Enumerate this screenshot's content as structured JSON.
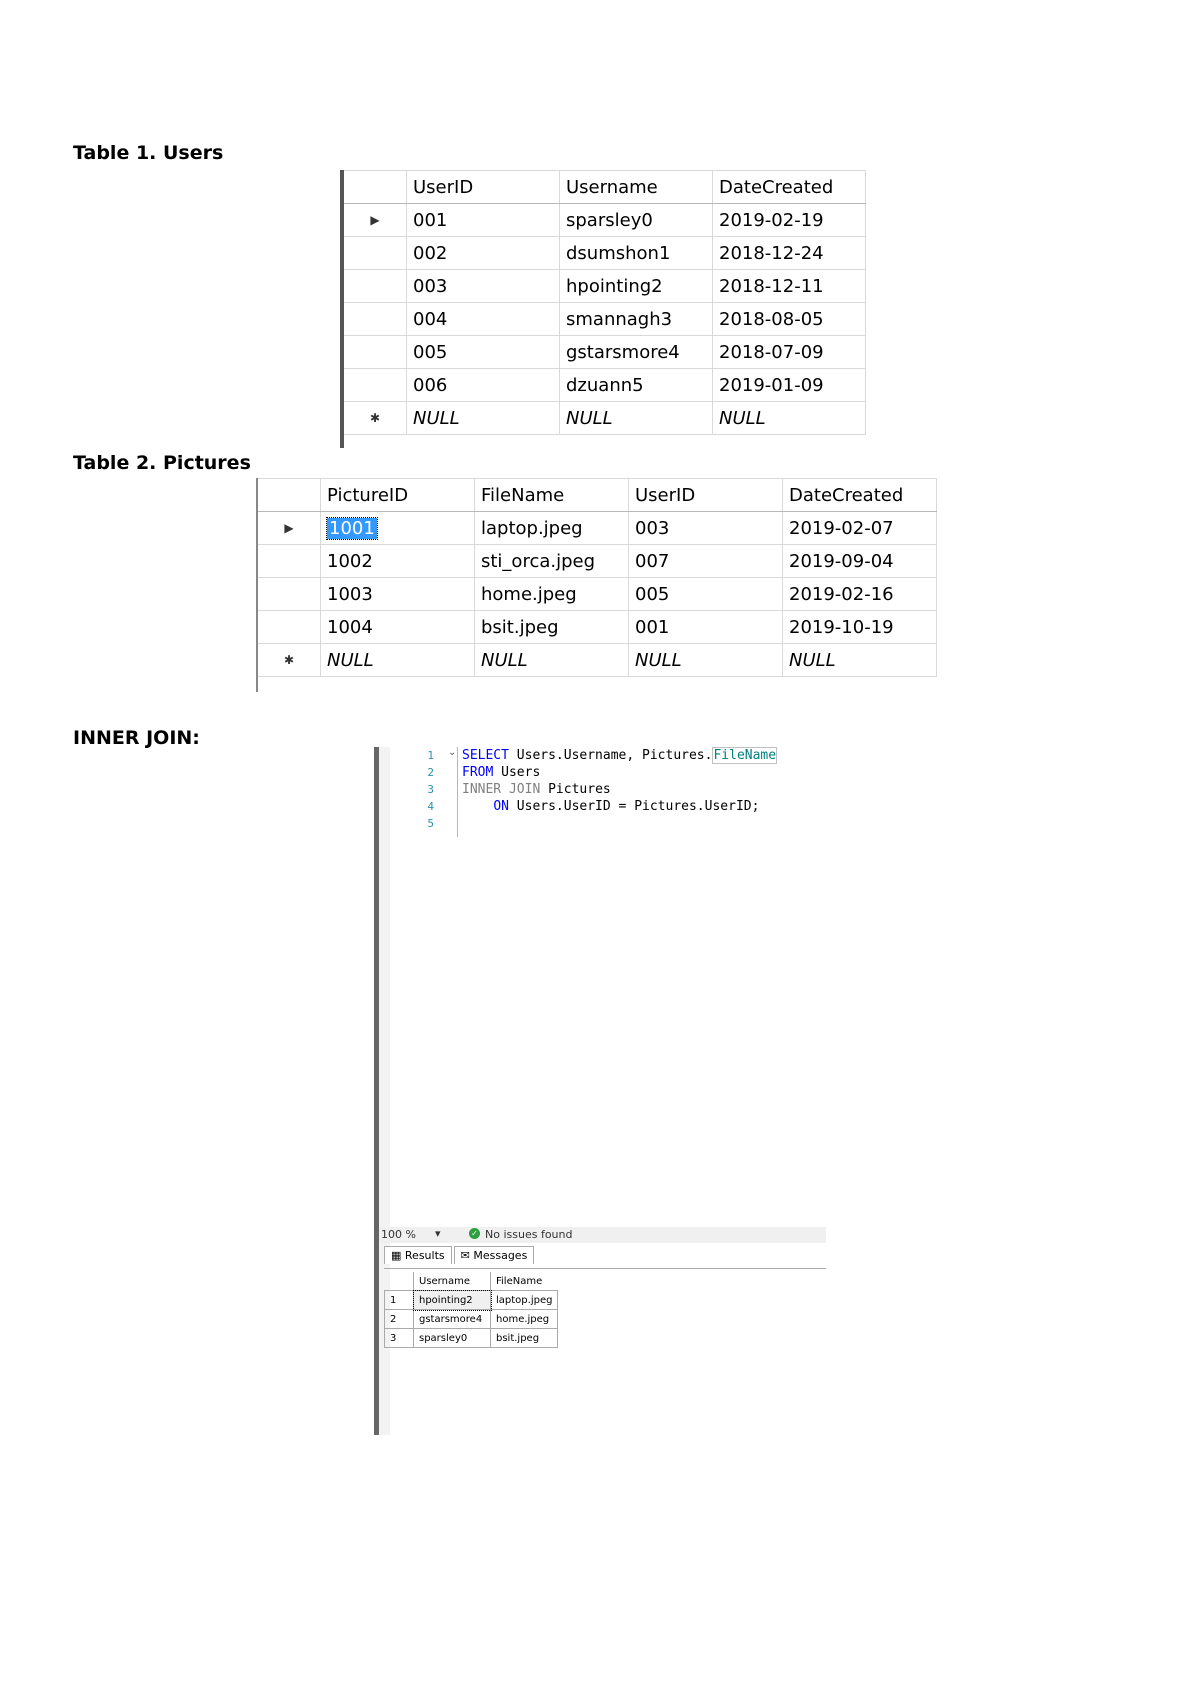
{
  "headings": {
    "users": "Table 1. Users",
    "pictures": "Table 2. Pictures",
    "inner_join": "INNER JOIN:"
  },
  "users": {
    "columns": [
      "UserID",
      "Username",
      "DateCreated"
    ],
    "rows": [
      [
        "001",
        "sparsley0",
        "2019-02-19"
      ],
      [
        "002",
        "dsumshon1",
        "2018-12-24"
      ],
      [
        "003",
        "hpointing2",
        "2018-12-11"
      ],
      [
        "004",
        "smannagh3",
        "2018-08-05"
      ],
      [
        "005",
        "gstarsmore4",
        "2018-07-09"
      ],
      [
        "006",
        "dzuann5",
        "2019-01-09"
      ]
    ],
    "null_row": [
      "NULL",
      "NULL",
      "NULL"
    ]
  },
  "pictures": {
    "columns": [
      "PictureID",
      "FileName",
      "UserID",
      "DateCreated"
    ],
    "rows": [
      [
        "1001",
        "laptop.jpeg",
        "003",
        "2019-02-07"
      ],
      [
        "1002",
        "sti_orca.jpeg",
        "007",
        "2019-09-04"
      ],
      [
        "1003",
        "home.jpeg",
        "005",
        "2019-02-16"
      ],
      [
        "1004",
        "bsit.jpeg",
        "001",
        "2019-10-19"
      ]
    ],
    "null_row": [
      "NULL",
      "NULL",
      "NULL",
      "NULL"
    ]
  },
  "editor": {
    "line_numbers": [
      "1",
      "2",
      "3",
      "4",
      "5"
    ],
    "code": {
      "l1_kw": "SELECT",
      "l1_rest": " Users.Username, Pictures.",
      "l1_sel": "FileName",
      "l2_kw": "FROM",
      "l2_rest": " Users",
      "l3_kw": "INNER JOIN",
      "l3_rest": " Pictures",
      "l4_kw": "ON",
      "l4_rest": " Users.UserID = Pictures.UserID;"
    },
    "zoom": "100 %",
    "status_text": "No issues found",
    "tabs": [
      "Results",
      "Messages"
    ]
  },
  "results": {
    "columns": [
      "Username",
      "FileName"
    ],
    "rows": [
      [
        "1",
        "hpointing2",
        "laptop.jpeg"
      ],
      [
        "2",
        "gstarsmore4",
        "home.jpeg"
      ],
      [
        "3",
        "sparsley0",
        "bsit.jpeg"
      ]
    ]
  }
}
